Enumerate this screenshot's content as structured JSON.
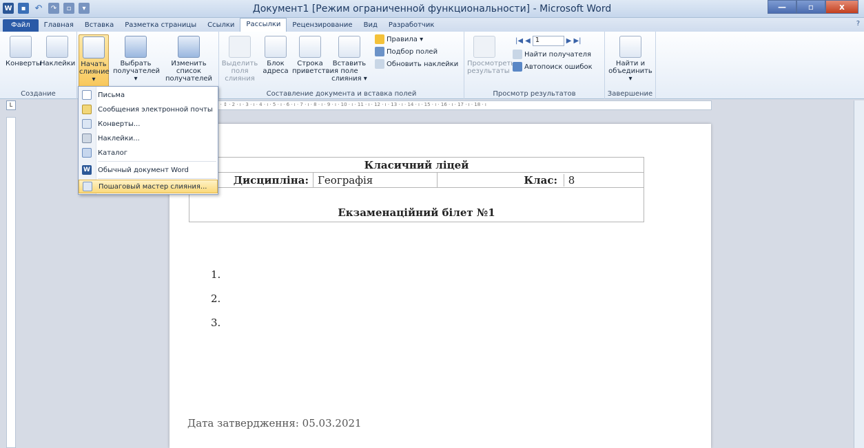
{
  "window": {
    "title": "Документ1 [Режим ограниченной функциональности]  -  Microsoft Word",
    "min": "—",
    "max": "▫",
    "close": "x",
    "help": "?"
  },
  "tabs": [
    "Файл",
    "Главная",
    "Вставка",
    "Разметка страницы",
    "Ссылки",
    "Рассылки",
    "Рецензирование",
    "Вид",
    "Разработчик"
  ],
  "ribbon": {
    "create_group": "Создание",
    "envelopes": "Конверты",
    "labels": "Наклейки",
    "start_merge": "Начать слияние ▾",
    "select_recipients": "Выбрать получателей ▾",
    "edit_list": "Изменить список получателей",
    "highlight_fields": "Выделить поля слияния",
    "address_block": "Блок адреса",
    "greeting_line": "Строка приветствия",
    "insert_field": "Вставить поле слияния ▾",
    "rules": "Правила ▾",
    "match_fields": "Подбор полей",
    "update_labels": "Обновить наклейки",
    "compose_group": "Составление документа и вставка полей",
    "preview_results": "Просмотреть результаты",
    "record_number": "1",
    "find_recipient": "Найти получателя",
    "auto_check": "Автопоиск ошибок",
    "preview_group": "Просмотр результатов",
    "finish_merge": "Найти и объединить ▾",
    "finish_group": "Завершение"
  },
  "ruler_text": "1 · ↕ · 2 · ı · 3 · ı · 4 · ı · 5 · ı · 6 · ı · 7 · ı · 8 · ı · 9 · ı · 10 · ı · 11 · ı · 12 · ı · 13 · ı · 14 · ı · 15 · ı · 16 · ı · 17 · ı · 18 · ı",
  "menu": [
    {
      "label": "Письма",
      "underline": "и"
    },
    {
      "label": "Сообщения электронной почты"
    },
    {
      "label": "Конверты..."
    },
    {
      "label": "Наклейки..."
    },
    {
      "label": "Каталог"
    },
    {
      "label": "Обычный документ Word"
    },
    {
      "label": "Пошаговый мастер слияния..."
    }
  ],
  "document": {
    "school": "Класичний ліцей",
    "discipline_label": "Дисципліна:",
    "discipline_value": "Географія",
    "class_label": "Клас:",
    "class_value": "8",
    "ticket": "Екзаменаційний білет №1",
    "list": [
      "1.",
      "2.",
      "3."
    ],
    "date": "Дата затвердження: 05.03.2021"
  }
}
